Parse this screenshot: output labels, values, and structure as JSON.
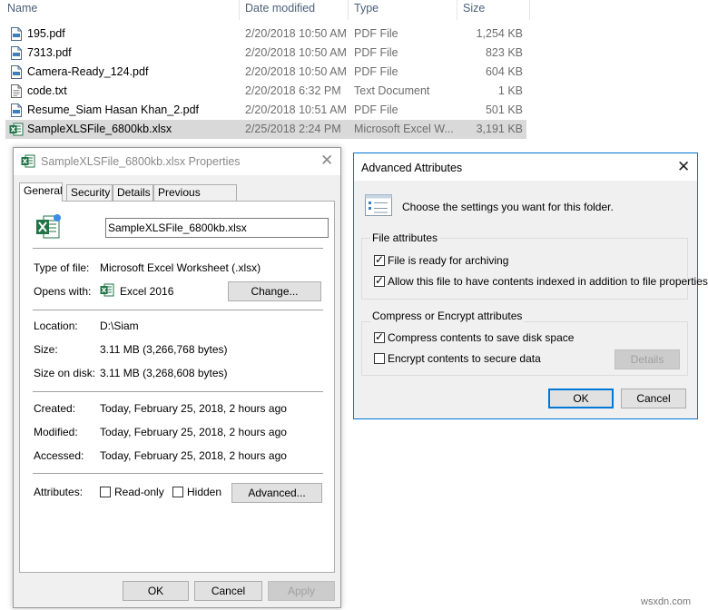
{
  "explorer": {
    "columns": {
      "name": "Name",
      "date": "Date modified",
      "type": "Type",
      "size": "Size"
    },
    "files": [
      {
        "name": "195.pdf",
        "date": "2/20/2018 10:50 AM",
        "type": "PDF File",
        "size": "1,254 KB",
        "icon": "pdf-icon"
      },
      {
        "name": "7313.pdf",
        "date": "2/20/2018 10:50 AM",
        "type": "PDF File",
        "size": "823 KB",
        "icon": "pdf-icon"
      },
      {
        "name": "Camera-Ready_124.pdf",
        "date": "2/20/2018 10:50 AM",
        "type": "PDF File",
        "size": "604 KB",
        "icon": "pdf-icon"
      },
      {
        "name": "code.txt",
        "date": "2/20/2018 6:32 PM",
        "type": "Text Document",
        "size": "1 KB",
        "icon": "text-file-icon"
      },
      {
        "name": "Resume_Siam Hasan Khan_2.pdf",
        "date": "2/20/2018 10:51 AM",
        "type": "PDF File",
        "size": "501 KB",
        "icon": "pdf-icon"
      },
      {
        "name": "SampleXLSFile_6800kb.xlsx",
        "date": "2/25/2018 2:24 PM",
        "type": "Microsoft Excel W...",
        "size": "3,191 KB",
        "icon": "excel-icon",
        "selected": true
      }
    ]
  },
  "properties": {
    "title": "SampleXLSFile_6800kb.xlsx Properties",
    "tabs": [
      "General",
      "Security",
      "Details",
      "Previous Versions"
    ],
    "active_tab": "General",
    "filename": "SampleXLSFile_6800kb.xlsx",
    "type_label": "Type of file:",
    "type_value": "Microsoft Excel Worksheet (.xlsx)",
    "opens_label": "Opens with:",
    "opens_value": "Excel 2016",
    "change_button": "Change...",
    "location_label": "Location:",
    "location_value": "D:\\Siam",
    "size_label": "Size:",
    "size_value": "3.11 MB (3,266,768 bytes)",
    "size_on_disk_label": "Size on disk:",
    "size_on_disk_value": "3.11 MB (3,268,608 bytes)",
    "created_label": "Created:",
    "created_value": "Today, February 25, 2018, 2 hours ago",
    "modified_label": "Modified:",
    "modified_value": "Today, February 25, 2018, 2 hours ago",
    "accessed_label": "Accessed:",
    "accessed_value": "Today, February 25, 2018, 2 hours ago",
    "attributes_label": "Attributes:",
    "readonly_label": "Read-only",
    "hidden_label": "Hidden",
    "advanced_button": "Advanced...",
    "ok_button": "OK",
    "cancel_button": "Cancel",
    "apply_button": "Apply"
  },
  "advanced": {
    "title": "Advanced Attributes",
    "description": "Choose the settings you want for this folder.",
    "file_attributes_title": "File attributes",
    "archive_label": "File is ready for archiving",
    "archive_checked": true,
    "index_label": "Allow this file to have contents indexed in addition to file properties",
    "index_checked": true,
    "compress_encrypt_title": "Compress or Encrypt attributes",
    "compress_label": "Compress contents to save disk space",
    "compress_checked": true,
    "encrypt_label": "Encrypt contents to secure data",
    "encrypt_checked": false,
    "details_button": "Details",
    "ok_button": "OK",
    "cancel_button": "Cancel"
  },
  "watermark": "wsxdn.com",
  "colors": {
    "accent": "#0078d7",
    "excel_green": "#217346",
    "selected_row": "#d9d9d9"
  }
}
